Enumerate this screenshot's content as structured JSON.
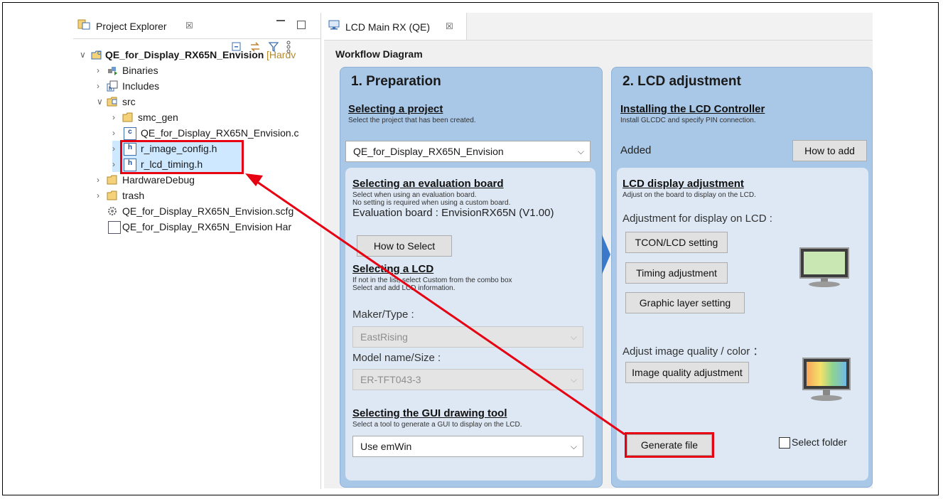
{
  "project_explorer": {
    "tab_title": "Project Explorer",
    "tab_close": "☒",
    "tree": [
      {
        "label": "QE_for_Display_RX65N_Envision",
        "suffix": "[Hardv"
      },
      {
        "label": "Binaries"
      },
      {
        "label": "Includes"
      },
      {
        "label": "src"
      },
      {
        "label": "smc_gen"
      },
      {
        "label": "QE_for_Display_RX65N_Envision.c"
      },
      {
        "label": "r_image_config.h"
      },
      {
        "label": "r_lcd_timing.h"
      },
      {
        "label": "HardwareDebug"
      },
      {
        "label": "trash"
      },
      {
        "label": "QE_for_Display_RX65N_Envision.scfg"
      },
      {
        "label": "QE_for_Display_RX65N_Envision Har"
      }
    ]
  },
  "editor": {
    "tab_title": "LCD Main RX (QE)",
    "tab_close": "☒",
    "workflow_title": "Workflow Diagram"
  },
  "prep": {
    "title": "1. Preparation",
    "select_project": {
      "title": "Selecting a project",
      "sub": "Select the project that has been created.",
      "value": "QE_for_Display_RX65N_Envision"
    },
    "eval_board": {
      "title": "Selecting an evaluation board",
      "sub1": "Select when using an evaluation board.",
      "sub2": "No setting is required when using a custom board.",
      "board_text": "Evaluation board : EnvisionRX65N (V1.00)",
      "how_to_select": "How to Select"
    },
    "lcd": {
      "title": "Selecting a LCD",
      "sub1": "If not in the list, select Custom from the combo box",
      "sub2": "Select and add LCD information.",
      "maker_label": "Maker/Type :",
      "maker_value": "EastRising",
      "model_label": "Model name/Size :",
      "model_value": "ER-TFT043-3"
    },
    "gui": {
      "title": "Selecting the GUI drawing tool",
      "sub": "Select a tool to generate a GUI to display on the LCD.",
      "value": "Use emWin"
    }
  },
  "lcd_adj": {
    "title": "2. LCD adjustment",
    "install": {
      "title": "Installing the LCD Controller",
      "sub": "Install GLCDC and specify PIN connection.",
      "status": "Added",
      "how_to_add": "How to add"
    },
    "display": {
      "title": "LCD display adjustment",
      "sub": "Adjust on the board to display on the LCD.",
      "adj_label": "Adjustment for display on LCD :",
      "tcon": "TCON/LCD setting",
      "timing": "Timing adjustment",
      "graphic": "Graphic layer setting",
      "quality_label": "Adjust image quality / color ：",
      "quality_btn": "Image quality adjustment",
      "generate": "Generate file",
      "select_folder": "Select folder"
    }
  },
  "colors": {
    "highlight_red": "#e60012",
    "panel_blue": "#a9c7e6",
    "inner_blue": "#dde8f4",
    "selection": "#cde8ff"
  }
}
